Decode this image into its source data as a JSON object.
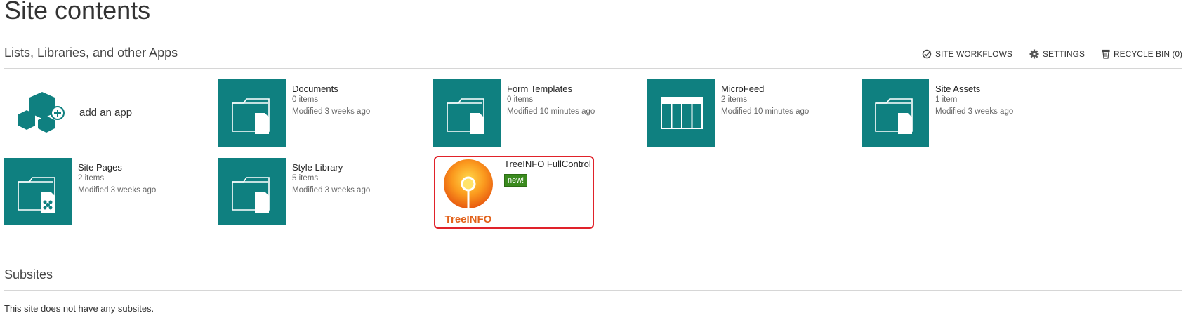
{
  "page_title": "Site contents",
  "lists_section_title": "Lists, Libraries, and other Apps",
  "toolbar": {
    "site_workflows": "SITE WORKFLOWS",
    "settings": "SETTINGS",
    "recycle_bin": "RECYCLE BIN (0)"
  },
  "add_app_label": "add an app",
  "apps": [
    {
      "name": "Documents",
      "items": "0 items",
      "modified": "Modified 3 weeks ago",
      "icon": "library-folder-icon"
    },
    {
      "name": "Form Templates",
      "items": "0 items",
      "modified": "Modified 10 minutes ago",
      "icon": "library-folder-icon"
    },
    {
      "name": "MicroFeed",
      "items": "2 items",
      "modified": "Modified 10 minutes ago",
      "icon": "list-table-icon"
    },
    {
      "name": "Site Assets",
      "items": "1 item",
      "modified": "Modified 3 weeks ago",
      "icon": "library-folder-icon"
    },
    {
      "name": "Site Pages",
      "items": "2 items",
      "modified": "Modified 3 weeks ago",
      "icon": "site-pages-folder-icon"
    },
    {
      "name": "Style Library",
      "items": "5 items",
      "modified": "Modified 3 weeks ago",
      "icon": "library-folder-icon"
    }
  ],
  "treeinfo": {
    "name": "TreeINFO FullControl",
    "badge": "new!",
    "logo_text": "TreeINFO"
  },
  "subsites_title": "Subsites",
  "subsites_text": "This site does not have any subsites.",
  "colors": {
    "tile_teal": "#0f8080",
    "highlight_red": "#e0222a",
    "new_badge_green": "#3a8a1e",
    "treeinfo_orange": "#f26b0f"
  }
}
